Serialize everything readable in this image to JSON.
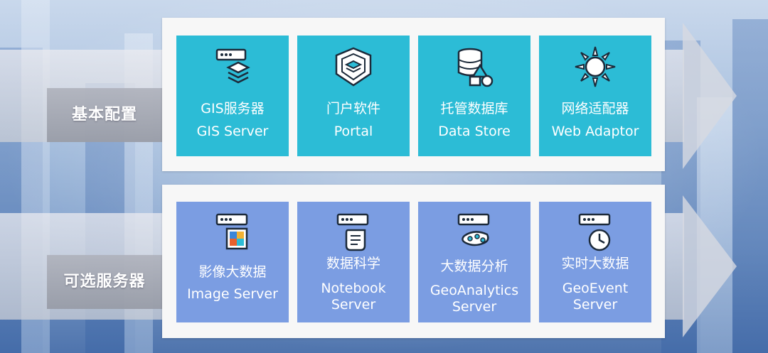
{
  "rows": [
    {
      "label": "基本配置",
      "tiles": [
        {
          "zh": "GIS服务器",
          "en": "GIS Server",
          "icon": "server-stack-icon"
        },
        {
          "zh": "门户软件",
          "en": "Portal",
          "icon": "portal-shield-icon"
        },
        {
          "zh": "托管数据库",
          "en": "Data Store",
          "icon": "database-shapes-icon"
        },
        {
          "zh": "网络适配器",
          "en": "Web Adaptor",
          "icon": "sun-adaptor-icon"
        }
      ]
    },
    {
      "label": "可选服务器",
      "tiles": [
        {
          "zh": "影像大数据",
          "en": "Image Server",
          "icon": "server-image-icon"
        },
        {
          "zh": "数据科学",
          "en_line1": "Notebook",
          "en_line2": "Server",
          "icon": "server-notebook-icon"
        },
        {
          "zh": "大数据分析",
          "en_line1": "GeoAnalytics",
          "en_line2": "Server",
          "icon": "server-analytics-icon"
        },
        {
          "zh": "实时大数据",
          "en_line1": "GeoEvent",
          "en_line2": "Server",
          "icon": "server-clock-icon"
        }
      ]
    }
  ],
  "colors": {
    "basic_tile": "#2cbcd6",
    "optional_tile": "#7b9de2",
    "panel": "#f7f7f7",
    "label_text": "#ffffff"
  }
}
